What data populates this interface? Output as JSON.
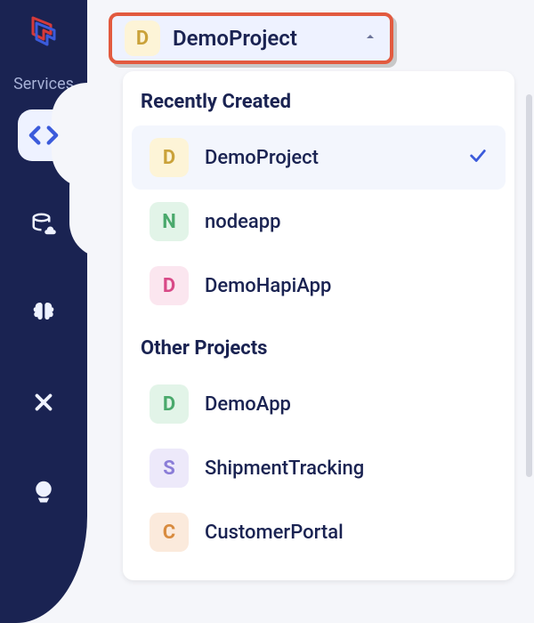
{
  "sidebar": {
    "services_label": "Services"
  },
  "selector": {
    "avatar_letter": "D",
    "avatar_color": "yellow",
    "name": "DemoProject"
  },
  "dropdown": {
    "recent_title": "Recently Created",
    "other_title": "Other Projects",
    "recent": [
      {
        "letter": "D",
        "color": "yellow",
        "label": "DemoProject",
        "selected": true
      },
      {
        "letter": "N",
        "color": "green",
        "label": "nodeapp",
        "selected": false
      },
      {
        "letter": "D",
        "color": "pink",
        "label": "DemoHapiApp",
        "selected": false
      }
    ],
    "other": [
      {
        "letter": "D",
        "color": "green",
        "label": "DemoApp",
        "selected": false
      },
      {
        "letter": "S",
        "color": "purple",
        "label": "ShipmentTracking",
        "selected": false
      },
      {
        "letter": "C",
        "color": "orange",
        "label": "CustomerPortal",
        "selected": false
      }
    ]
  }
}
